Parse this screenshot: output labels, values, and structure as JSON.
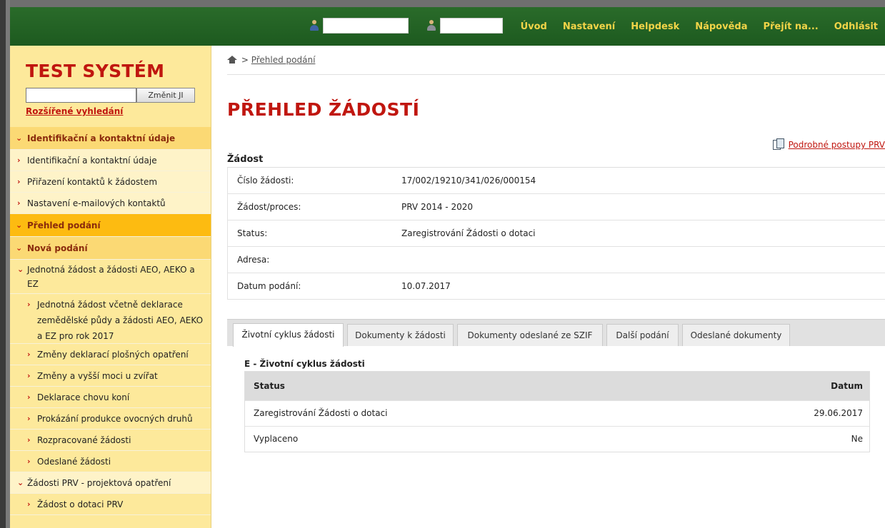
{
  "topbar": {
    "nav": [
      "Úvod",
      "Nastavení",
      "Helpdesk",
      "Nápověda",
      "Přejít na...",
      "Odhlásit"
    ]
  },
  "sidebar": {
    "title": "TEST SYSTÉM",
    "search_button": "Změnit JI",
    "advanced_search": "Rozšířené vyhledání",
    "items": [
      {
        "label": "Identifikační a kontaktní údaje",
        "level": 0
      },
      {
        "label": "Identifikační a kontaktní údaje",
        "level": 1
      },
      {
        "label": "Přiřazení kontaktů k žádostem",
        "level": 1
      },
      {
        "label": "Nastavení e-mailových kontaktů",
        "level": 1
      },
      {
        "label": "Přehled podání",
        "level": 0,
        "active": true
      },
      {
        "label": "Nová podání",
        "level": 0
      },
      {
        "label": "Jednotná žádost a žádosti AEO, AEKO a EZ",
        "level": 1
      },
      {
        "label": "Jednotná žádost včetně deklarace zemědělské půdy a žádosti AEO, AEKO a EZ pro rok 2017",
        "level": 2
      },
      {
        "label": "Změny deklarací plošných opatření",
        "level": 2
      },
      {
        "label": "Změny a vyšší moci u zvířat",
        "level": 2
      },
      {
        "label": "Deklarace chovu koní",
        "level": 2
      },
      {
        "label": "Prokázání produkce ovocných druhů",
        "level": 2
      },
      {
        "label": "Rozpracované žádosti",
        "level": 2
      },
      {
        "label": "Odeslané žádosti",
        "level": 2
      },
      {
        "label": "Žádosti PRV - projektová opatření",
        "level": 1
      },
      {
        "label": "Žádost o dotaci PRV",
        "level": 2
      }
    ]
  },
  "breadcrumb": {
    "current": "Přehled podání"
  },
  "page": {
    "title": "PŘEHLED ŽÁDOSTÍ",
    "detail_link": "Podrobné postupy PRV",
    "section": "Žádost"
  },
  "details": [
    {
      "key": "Číslo žádosti:",
      "value": "17/002/19210/341/026/000154"
    },
    {
      "key": "Žádost/proces:",
      "value": "PRV 2014 - 2020"
    },
    {
      "key": "Status:",
      "value": "Zaregistrování Žádosti o dotaci"
    },
    {
      "key": "Adresa:",
      "value": ""
    },
    {
      "key": "Datum podání:",
      "value": "10.07.2017"
    }
  ],
  "tabs": [
    "Životní cyklus žádosti",
    "Dokumenty k žádosti",
    "Dokumenty odeslané ze SZIF",
    "Další podání",
    "Odeslané dokumenty"
  ],
  "lifecycle": {
    "title": "E - Životní cyklus žádosti",
    "headers": [
      "Status",
      "Datum"
    ],
    "rows": [
      [
        "Zaregistrování Žádosti o dotaci",
        "29.06.2017"
      ],
      [
        "Vyplaceno",
        "Ne"
      ]
    ]
  },
  "colors": {
    "topbar": "#1d5a1f",
    "nav_text": "#f2d448",
    "accent_red": "#c0160f",
    "sidebar_bg": "#fde99b",
    "sidebar_active": "#fdbb11"
  }
}
